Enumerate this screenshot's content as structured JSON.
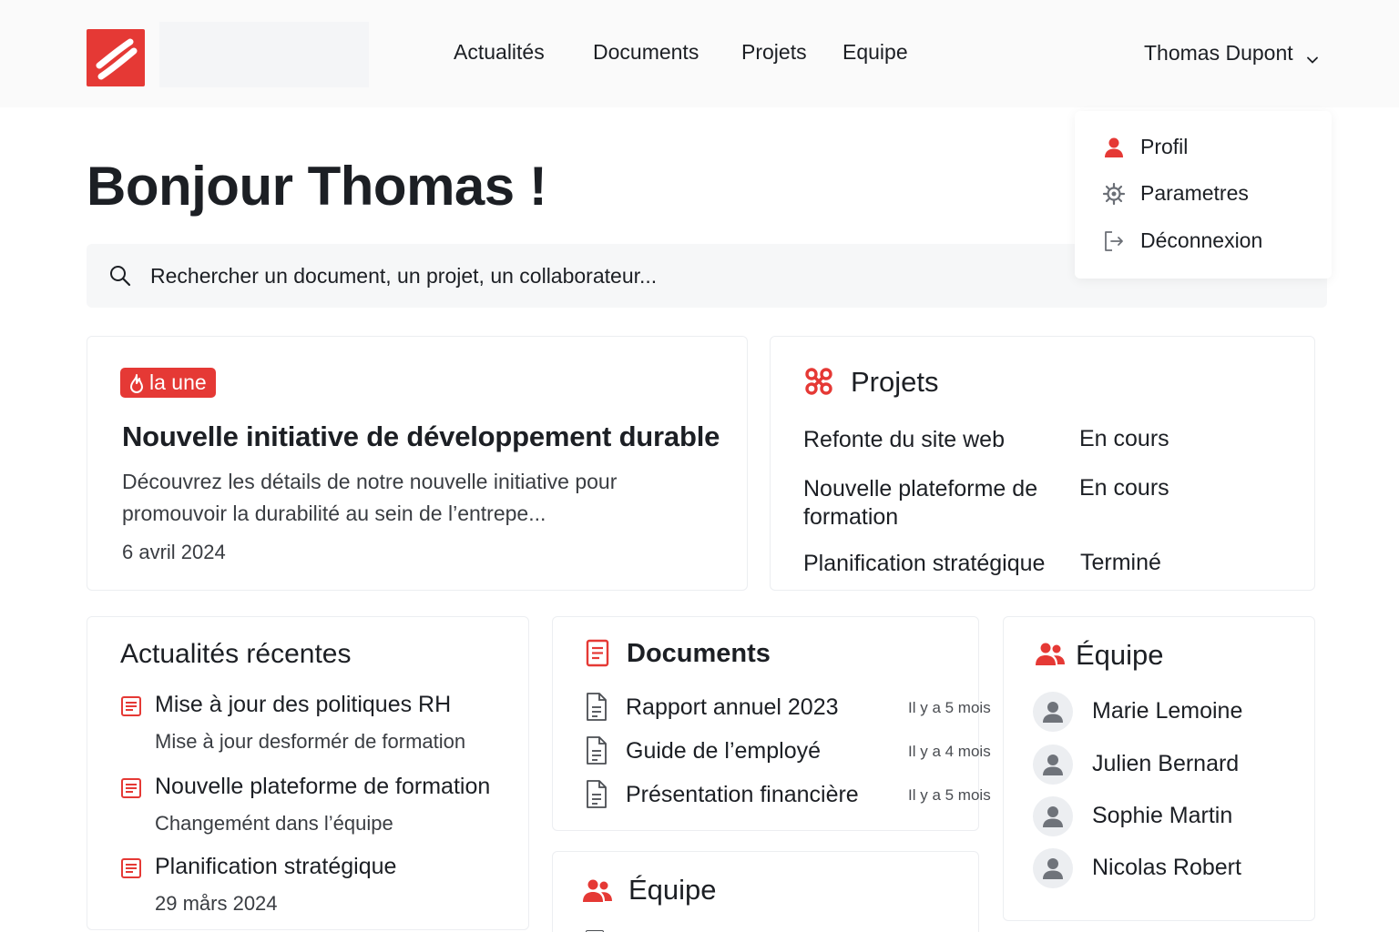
{
  "colors": {
    "accent": "#e53935",
    "text": "#1c1f24",
    "muted": "#3a3d42"
  },
  "nav": {
    "items": [
      {
        "label": "Actualités"
      },
      {
        "label": "Documents"
      },
      {
        "label": "Projets"
      },
      {
        "label": "Equipe"
      }
    ],
    "user_name": "Thomas Dupont"
  },
  "user_dropdown": {
    "items": [
      {
        "label": "Profil",
        "icon": "user-icon"
      },
      {
        "label": "Parametres",
        "icon": "gear-icon"
      },
      {
        "label": "Déconnexion",
        "icon": "logout-icon"
      }
    ]
  },
  "greeting": "Bonjour Thomas !",
  "search": {
    "placeholder": "Rechercher un document, un projet, un collaborateur..."
  },
  "featured": {
    "badge": "la une",
    "title": "Nouvelle initiative de développement durable",
    "excerpt": "Découvrez les détails de notre nouvelle initiative pour promouvoir la durabilité au sein de l’entrepe...",
    "date": "6 avril 2024"
  },
  "projects": {
    "title": "Projets",
    "items": [
      {
        "name": "Refonte du site web",
        "status": "En cours"
      },
      {
        "name": "Nouvelle plateforme de formation",
        "status": "En cours"
      },
      {
        "name": "Planification stratégique",
        "status": "Terminé"
      }
    ]
  },
  "news": {
    "title": "Actualités récentes",
    "items": [
      {
        "title": "Mise à jour des politiques RH",
        "subtitle": "Mise à jour desformér de formation"
      },
      {
        "title": "Nouvelle plateforme de formation",
        "subtitle": "Changemént dans l’équipe"
      },
      {
        "title": "Planification stratégique",
        "subtitle": "29 mårs 2024"
      }
    ]
  },
  "documents": {
    "title": "Documents",
    "items": [
      {
        "name": "Rapport annuel 2023",
        "time": "Il y a 5 mois"
      },
      {
        "name": "Guide de l’employé",
        "time": "Il y a 4 mois"
      },
      {
        "name": "Présentation financière",
        "time": "Il y a 5 mois"
      }
    ]
  },
  "team_secondary": {
    "title": "Équipe"
  },
  "team": {
    "title": "Équipe",
    "members": [
      {
        "name": "Marie Lemoine"
      },
      {
        "name": "Julien Bernard"
      },
      {
        "name": "Sophie Martin"
      },
      {
        "name": "Nicolas Robert"
      }
    ]
  }
}
